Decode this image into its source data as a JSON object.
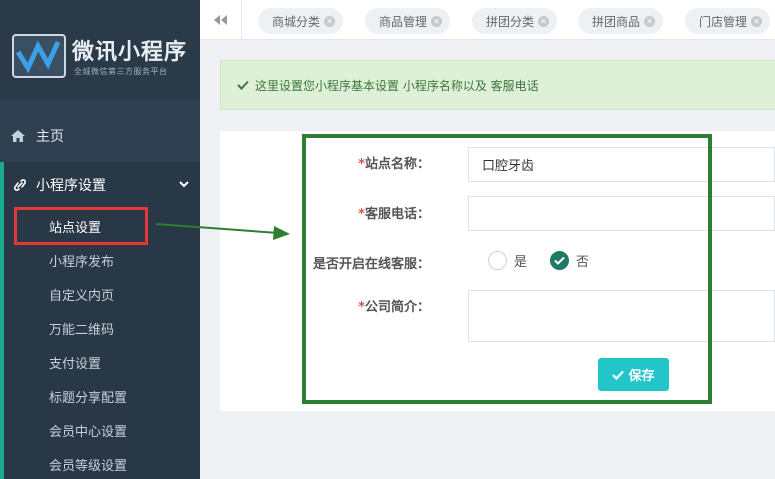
{
  "logo": {
    "title": "微讯小程序",
    "subtitle": "全城微信第三方服务平台"
  },
  "nav": {
    "home": "主页",
    "group": {
      "label": "小程序设置",
      "items": [
        {
          "label": "站点设置"
        },
        {
          "label": "小程序发布"
        },
        {
          "label": "自定义内页"
        },
        {
          "label": "万能二维码"
        },
        {
          "label": "支付设置"
        },
        {
          "label": "标题分享配置"
        },
        {
          "label": "会员中心设置"
        },
        {
          "label": "会员等级设置"
        }
      ]
    }
  },
  "tabs": [
    {
      "label": "商城分类"
    },
    {
      "label": "商品管理"
    },
    {
      "label": "拼团分类"
    },
    {
      "label": "拼团商品"
    },
    {
      "label": "门店管理"
    }
  ],
  "alert": {
    "text": "这里设置您小程序基本设置 小程序名称以及 客服电话"
  },
  "form": {
    "required_mark": "*",
    "site_name": {
      "label": "站点名称：",
      "value": "口腔牙齿"
    },
    "phone": {
      "label": "客服电话：",
      "value": ""
    },
    "online_service": {
      "label": "是否开启在线客服：",
      "yes": "是",
      "no": "否",
      "selected": "否"
    },
    "intro": {
      "label": "公司简介：",
      "value": ""
    },
    "save_label": "保存"
  },
  "colors": {
    "sidebar": "#2f4050",
    "accent": "#19aa8d",
    "save": "#23c6c8",
    "annotation_red": "#e53935",
    "annotation_green": "#2e7d32"
  }
}
